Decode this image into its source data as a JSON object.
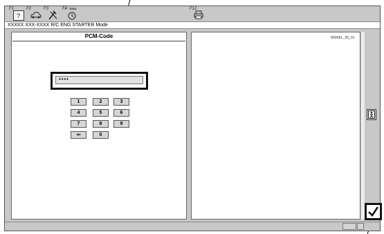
{
  "toolbar": {
    "f1": "F1",
    "f2": "F2",
    "f3": "F3",
    "f4": "F4",
    "f4_sub": "TOOL",
    "f12": "F12"
  },
  "mode_text": "XXXXX XXX-XXXX R/C ENG STARTER Mode",
  "left_panel": {
    "title": "PCM-Code",
    "code_value": "****",
    "keypad": [
      "1",
      "2",
      "3",
      "4",
      "5",
      "6",
      "7",
      "8",
      "9",
      "⇦",
      "0"
    ]
  },
  "right_panel": {
    "image_id": "IM3KEL_00_01"
  },
  "icons": {
    "f1": "help-icon",
    "f2": "car-icon",
    "f3": "tools-icon",
    "f4": "tool-clock-icon",
    "f12": "print-icon",
    "side": "person-exit-icon",
    "confirm": "checkmark-icon"
  }
}
